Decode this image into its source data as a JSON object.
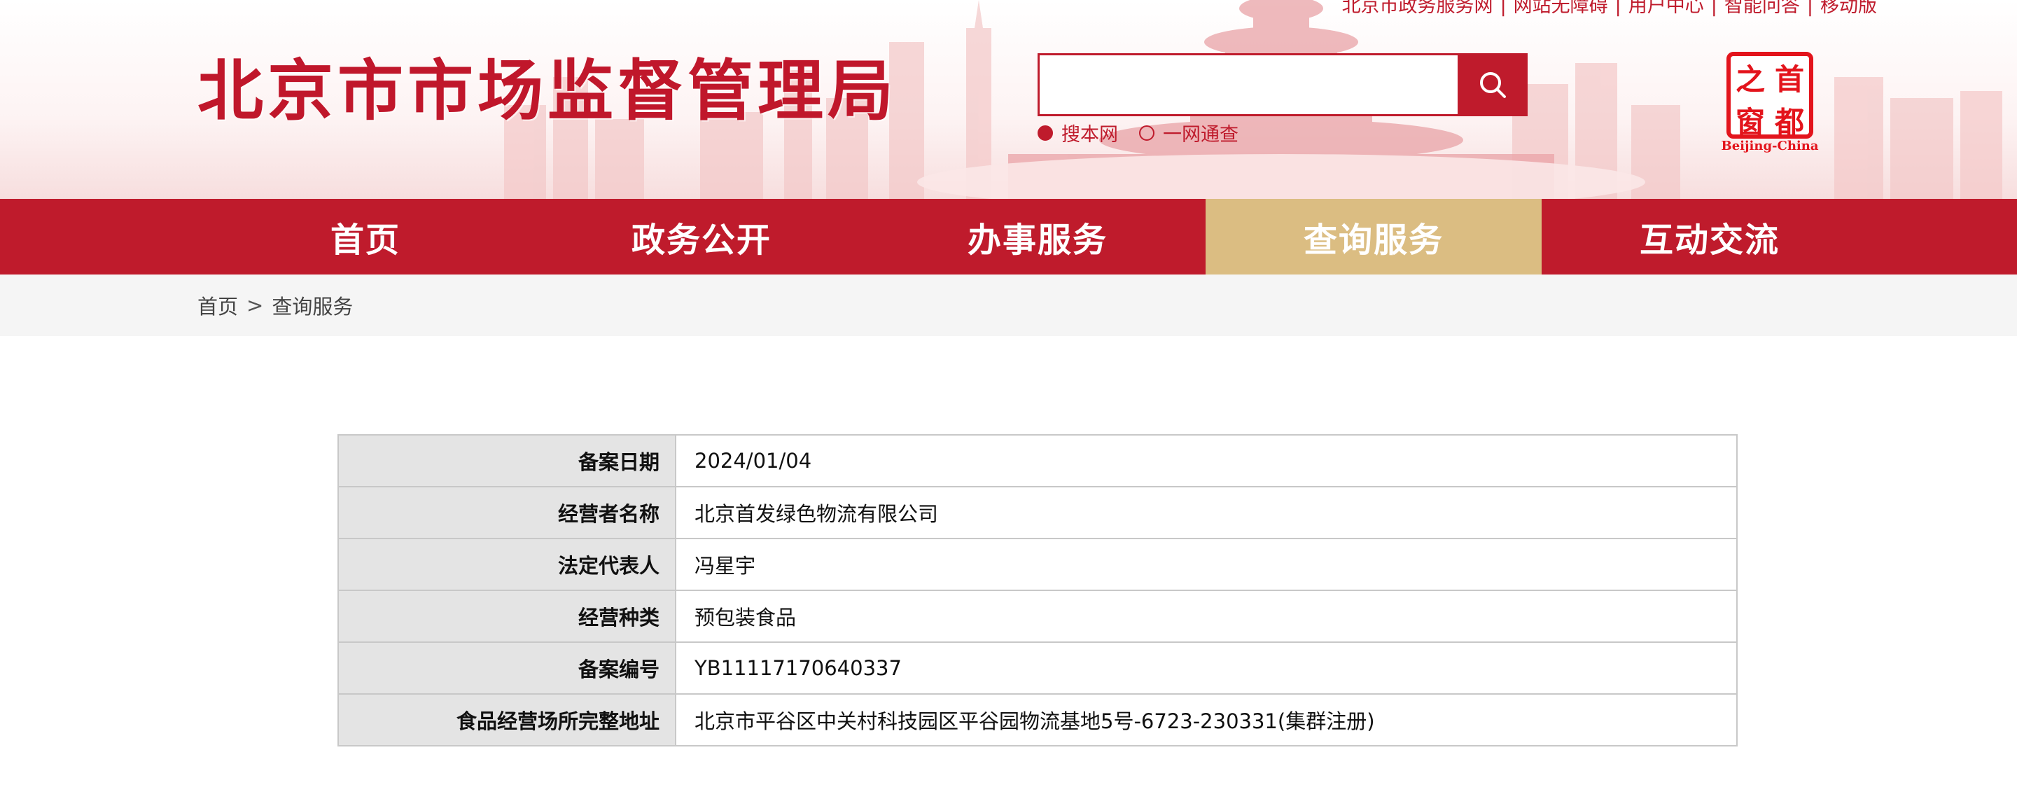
{
  "header": {
    "top_links": [
      "北京市政务服务网",
      "网站无障碍",
      "用户中心",
      "智能问答",
      "移动版"
    ],
    "site_title": "北京市市场监督管理局",
    "search": {
      "placeholder": "",
      "scopes": [
        {
          "label": "搜本网",
          "checked": true
        },
        {
          "label": "一网通查",
          "checked": false
        }
      ]
    },
    "capital_logo": {
      "chars": [
        "之",
        "首",
        "窗",
        "都"
      ],
      "subtitle": "Beijing-China"
    }
  },
  "nav": {
    "items": [
      {
        "label": "首页",
        "active": false
      },
      {
        "label": "政务公开",
        "active": false
      },
      {
        "label": "办事服务",
        "active": false
      },
      {
        "label": "查询服务",
        "active": true
      },
      {
        "label": "互动交流",
        "active": false
      }
    ]
  },
  "breadcrumb": {
    "home": "首页",
    "separator": ">",
    "current": "查询服务"
  },
  "record": {
    "rows": [
      {
        "label": "备案日期",
        "value": "2024/01/04"
      },
      {
        "label": "经营者名称",
        "value": "北京首发绿色物流有限公司"
      },
      {
        "label": "法定代表人",
        "value": "冯星宇"
      },
      {
        "label": "经营种类",
        "value": "预包装食品"
      },
      {
        "label": "备案编号",
        "value": "YB11117170640337"
      },
      {
        "label": "食品经营场所完整地址",
        "value": "北京市平谷区中关村科技园区平谷园物流基地5号-6723-230331(集群注册)"
      }
    ]
  },
  "colors": {
    "brand_red": "#bf1b2c",
    "nav_active": "#dbbd82",
    "logo_red": "#e3141c"
  }
}
